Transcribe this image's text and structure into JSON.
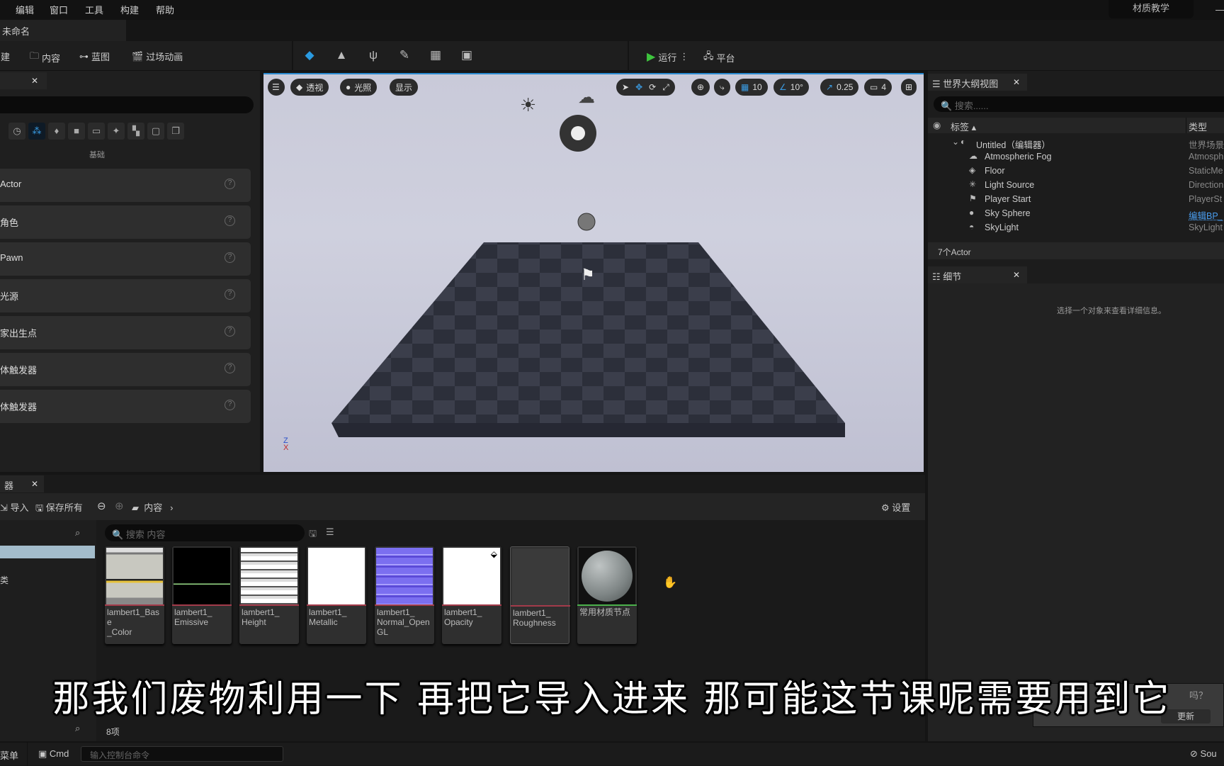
{
  "menu": [
    "编辑",
    "窗口",
    "工具",
    "构建",
    "帮助"
  ],
  "project_name": "材质教学",
  "doc_tab": "未命名",
  "toolbar": {
    "create": "创建",
    "content": "内容",
    "blueprint": "蓝图",
    "cinematics": "过场动画",
    "play": "运行",
    "platform": "平台"
  },
  "place_panel": {
    "category": "基础",
    "items": [
      "Actor",
      "角色",
      "Pawn",
      "光源",
      "玩家出生点",
      "立方体触发器",
      "球体触发器"
    ],
    "items_visible": [
      "Actor",
      "角色",
      "Pawn",
      "光源",
      "家出生点",
      "体触发器",
      "体触发器"
    ]
  },
  "viewport": {
    "perspective": "透视",
    "lit": "光照",
    "show": "显示",
    "grid": "10",
    "angle": "10°",
    "scale": "0.25",
    "camera_speed": "4"
  },
  "outliner": {
    "title": "世界大纲视图",
    "search_placeholder": "搜索......",
    "col_label": "标签",
    "col_type": "类型",
    "rows": [
      {
        "name": "Untitled（编辑器）",
        "type": "世界场景"
      },
      {
        "name": "Atmospheric Fog",
        "type": "Atmosph"
      },
      {
        "name": "Floor",
        "type": "StaticMe"
      },
      {
        "name": "Light Source",
        "type": "Direction"
      },
      {
        "name": "Player Start",
        "type": "PlayerSt"
      },
      {
        "name": "Sky Sphere",
        "type": "编辑BP_"
      },
      {
        "name": "SkyLight",
        "type": "SkyLight"
      }
    ],
    "count": "7个Actor"
  },
  "details": {
    "title": "细节",
    "empty": "选择一个对象来查看详细信息。"
  },
  "content_browser": {
    "tab": "器",
    "import": "导入",
    "save_all": "保存所有",
    "path": "内容",
    "settings": "设置",
    "search_placeholder": "搜索 内容",
    "left_label": "类",
    "count": "8项",
    "assets": [
      {
        "l1": "lambert1_Base",
        "l2": "_Color",
        "l3": ""
      },
      {
        "l1": "lambert1_",
        "l2": "Emissive",
        "l3": ""
      },
      {
        "l1": "lambert1_",
        "l2": "Height",
        "l3": ""
      },
      {
        "l1": "lambert1_",
        "l2": "Metallic",
        "l3": ""
      },
      {
        "l1": "lambert1_",
        "l2": "Normal_Open",
        "l3": "GL"
      },
      {
        "l1": "lambert1_",
        "l2": "Opacity",
        "l3": ""
      },
      {
        "l1": "lambert1_",
        "l2": "Roughness",
        "l3": ""
      },
      {
        "l1": "常用材质节点",
        "l2": "",
        "l3": ""
      }
    ]
  },
  "status": {
    "menu": "菜单",
    "cmd": "Cmd",
    "console_placeholder": "输入控制台命令",
    "source": "Sou"
  },
  "notification": {
    "text": "吗？",
    "button": "更新"
  },
  "subtitle": "那我们废物利用一下 再把它导入进来 那可能这节课呢需要用到它",
  "colors": {
    "accent": "#2a8ad0",
    "play": "#3ec43e",
    "texture_bar": "#a33b4a",
    "material_bar": "#4bb04b"
  }
}
